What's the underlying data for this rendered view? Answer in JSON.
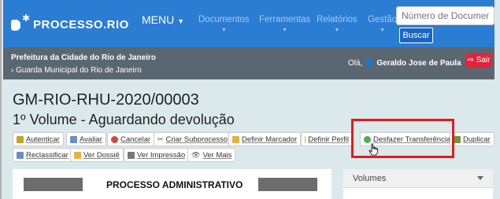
{
  "navbar": {
    "logo_text": "PROCESSO.RIO",
    "menu_label": "MENU",
    "items": [
      {
        "label": "Documentos"
      },
      {
        "label": "Ferramentas"
      },
      {
        "label": "Relatórios"
      },
      {
        "label": "Gestão"
      }
    ],
    "search_placeholder": "Número de Documento",
    "search_button": "Buscar"
  },
  "header": {
    "org_line1": "Prefeitura da Cidade do Rio de Janeiro",
    "org_line2": "Guarda Municipal do Rio de Janeiro",
    "greeting": "Olá,",
    "user_name": "Geraldo Jose de Paula",
    "logout": "Sair"
  },
  "document": {
    "code": "GM-RIO-RHU-2020/00003",
    "status": "1º Volume - Aguardando devolução",
    "panel_title": "PROCESSO ADMINISTRATIVO"
  },
  "toolbar": {
    "row1": [
      {
        "label": "Autenticar",
        "icon": "certificate-icon",
        "color": "#c9a227"
      },
      {
        "label": "Avaliar",
        "icon": "document-icon",
        "color": "#6a8fc7"
      },
      {
        "label": "Cancelar",
        "icon": "cancel-icon",
        "color": "#d9453b"
      },
      {
        "label": "Criar Subprocesso",
        "icon": "scissors-icon",
        "color": "#555555"
      },
      {
        "label": "Definir Marcador",
        "icon": "folder-icon",
        "color": "#e3b341"
      },
      {
        "label": "Definir Perfil",
        "icon": "folder-icon",
        "color": "#e3b341"
      },
      {
        "label": "Desfazer Transferência",
        "icon": "undo-icon",
        "color": "#4caf50"
      },
      {
        "label": "Duplicar",
        "icon": "duplicate-icon",
        "color": "#6a9a3a"
      }
    ],
    "row2": [
      {
        "label": "Reclassificar",
        "icon": "document-icon",
        "color": "#6a8fc7"
      },
      {
        "label": "Ver Dossiê",
        "icon": "folder-icon",
        "color": "#e3b341"
      },
      {
        "label": "Ver Impressão",
        "icon": "printer-icon",
        "color": "#555555"
      },
      {
        "label": "Ver Mais",
        "icon": "eye-icon",
        "color": "#555555"
      }
    ]
  },
  "volumes": {
    "title": "Volumes"
  },
  "colors": {
    "navbar": "#2b7cd3",
    "band": "#5b6770",
    "highlight": "#e11b1b",
    "logout": "#e0243b"
  }
}
